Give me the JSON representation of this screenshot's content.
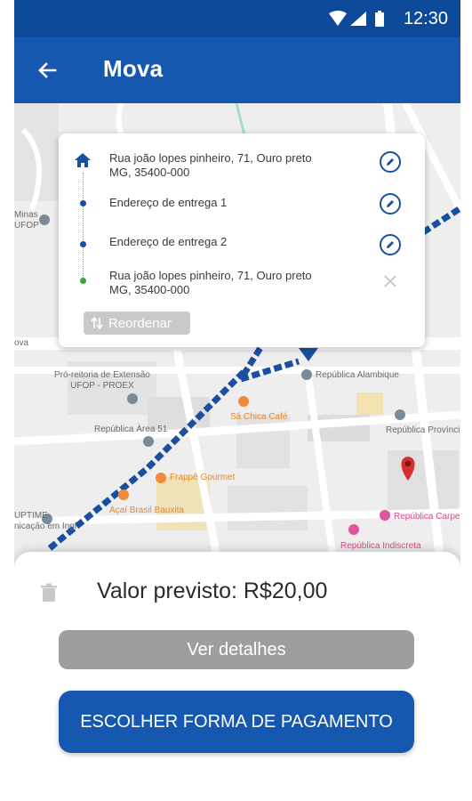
{
  "status_bar": {
    "time": "12:30"
  },
  "app_bar": {
    "title": "Mova",
    "back_icon": "arrow-left-icon"
  },
  "map": {
    "labels": {
      "minas_ufop": "Minas\nUFOP",
      "pro_reitoria": "Pró-reitoria de Extensão\nUFOP - PROEX",
      "republica_alambique": "República Alambique",
      "sa_chica_cafe": "Sá Chica Café",
      "republica_provincia": "República Provínci",
      "republica_area51": "República Área 51",
      "frappe_gourmet": "Frappê Gourmet",
      "acai_brasil": "Açaí Brasil Bauxita",
      "uptime": "UPTIME-\nnicação em Ingl",
      "republica_carpe": "República Carpe",
      "republica_indiscreta": "República Indiscreta",
      "nova": "ova"
    },
    "route_color": "#1a4fa0",
    "destination_pin_color": "#d32f2f"
  },
  "route_card": {
    "stops": [
      {
        "type": "origin",
        "icon": "home-icon",
        "text": "Rua joão lopes pinheiro, 71, Ouro preto\nMG, 35400-000",
        "action_icon": "edit-icon"
      },
      {
        "type": "delivery",
        "icon": "dot",
        "text": "Endereço de entrega 1",
        "action_icon": "edit-icon"
      },
      {
        "type": "delivery",
        "icon": "dot",
        "text": "Endereço de entrega 2",
        "action_icon": "edit-icon"
      },
      {
        "type": "return",
        "icon": "dot-green",
        "text": "Rua joão lopes pinheiro, 71, Ouro preto\nMG, 35400-000",
        "action_icon": "close-icon"
      }
    ],
    "reorder_label": "Reordenar"
  },
  "bottom_sheet": {
    "price_label": "Valor previsto: R$20,00",
    "details_button": "Ver detalhes",
    "payment_button": "ESCOLHER FORMA DE PAGAMENTO"
  },
  "colors": {
    "primary": "#1658b0",
    "status_bar": "#0d4a9a",
    "details_button": "#9e9e9e"
  }
}
